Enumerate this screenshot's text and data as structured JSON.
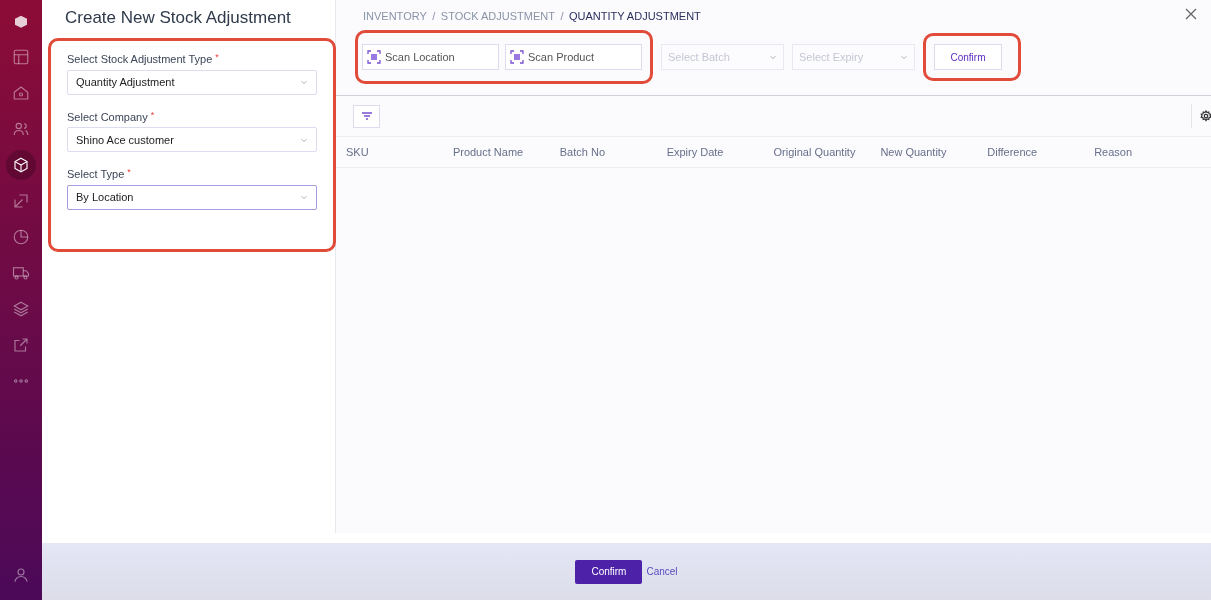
{
  "sidebar": {
    "items": [
      {
        "selected": false
      },
      {
        "selected": false
      },
      {
        "selected": false
      },
      {
        "selected": true
      },
      {
        "selected": false
      },
      {
        "selected": false
      },
      {
        "selected": false
      },
      {
        "selected": false
      },
      {
        "selected": false
      },
      {
        "selected": false
      }
    ]
  },
  "form_panel": {
    "title": "Create New Stock Adjustment",
    "highlighted": true,
    "fields": [
      {
        "label": "Select Stock Adjustment Type",
        "required": "*",
        "value": "Quantity Adjustment",
        "focused": false
      },
      {
        "label": "Select Company",
        "required": "*",
        "value": "Shino Ace customer",
        "focused": false
      },
      {
        "label": "Select Type",
        "required": "*",
        "value": "By Location",
        "focused": true
      }
    ]
  },
  "breadcrumb": [
    {
      "label": "INVENTORY",
      "current": false
    },
    {
      "separator": "/",
      "label": "STOCK ADJUSTMENT",
      "current": false
    },
    {
      "separator": "/",
      "label": "QUANTITY ADJUSTMENT",
      "current": true
    }
  ],
  "toolbar": {
    "scan_highlighted": true,
    "scan_fields": [
      {
        "placeholder": "Scan Location"
      },
      {
        "placeholder": "Scan Product"
      }
    ],
    "selects": [
      {
        "placeholder": "Select Batch",
        "disabled": true
      },
      {
        "placeholder": "Select Expiry",
        "disabled": true
      }
    ],
    "confirm": {
      "label": "Confirm",
      "highlighted": true
    }
  },
  "table": {
    "columns": [
      "SKU",
      "Product Name",
      "Batch No",
      "Expiry Date",
      "Original Quantity",
      "New Quantity",
      "Difference",
      "Reason"
    ]
  },
  "footer": {
    "primary": "Confirm",
    "secondary": "Cancel"
  }
}
